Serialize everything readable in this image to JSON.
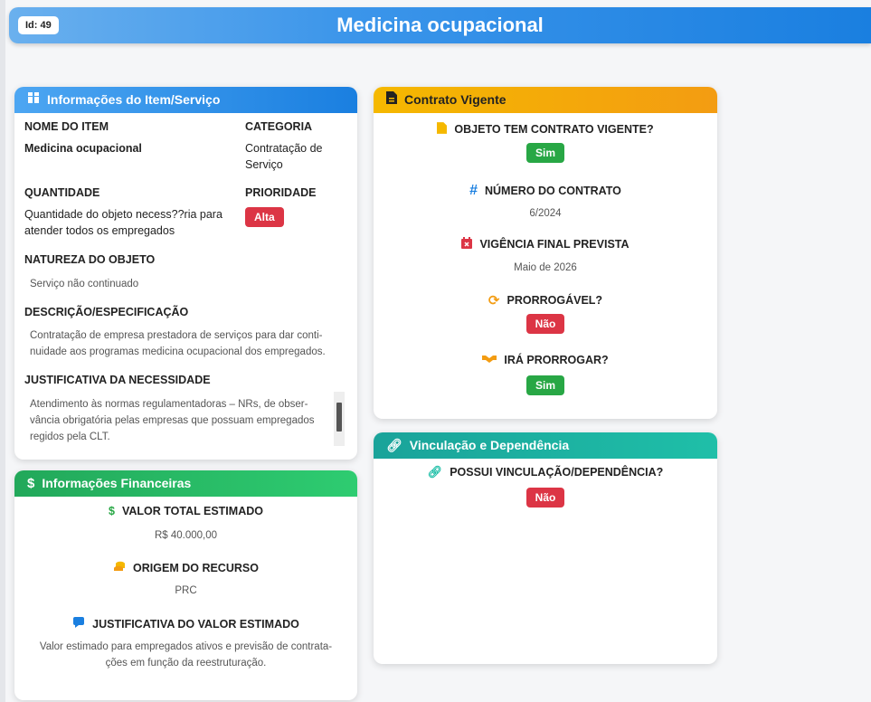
{
  "header": {
    "id_badge": "Id: 49",
    "title": "Medicina ocupacional"
  },
  "item_card": {
    "title": "Informações do Item/Serviço",
    "nome_label": "NOME DO ITEM",
    "nome_value": "Medicina ocupacional",
    "categoria_label": "CATEGORIA",
    "categoria_value": "Contratação de Serviço",
    "quantidade_label": "QUANTIDADE",
    "quantidade_value": "Quantidade do objeto necess??ria para atender todos os empregados",
    "prioridade_label": "PRIORIDADE",
    "prioridade_value": "Alta",
    "natureza_label": "NATUREZA DO OBJETO",
    "natureza_value": "Serviço não continuado",
    "descricao_label": "DESCRIÇÃO/ESPECIFICAÇÃO",
    "descricao_value": "Contratação de empresa prestadora de serviços para dar conti-nuidade aos programas medicina ocupacional dos empregados.",
    "justificativa_label": "JUSTIFICATIVA DA NECESSIDADE",
    "justificativa_value": "Atendimento às normas regulamentadoras – NRs, de obser-vância obrigatória pelas empresas que possuam empregados regidos pela CLT."
  },
  "finance_card": {
    "title": "Informações Financeiras",
    "valor_label": "VALOR TOTAL ESTIMADO",
    "valor_value": "R$ 40.000,00",
    "origem_label": "ORIGEM DO RECURSO",
    "origem_value": "PRC",
    "just_label": "JUSTIFICATIVA DO VALOR ESTIMADO",
    "just_value": "Valor estimado para empregados ativos e previsão de contrata-ções em função da reestruturação."
  },
  "contract_card": {
    "title": "Contrato Vigente",
    "objeto_label": "OBJETO TEM CONTRATO VIGENTE?",
    "objeto_value": "Sim",
    "numero_label": "NÚMERO DO CONTRATO",
    "numero_value": "6/2024",
    "vigencia_label": "VIGÊNCIA FINAL PREVISTA",
    "vigencia_value": "Maio de 2026",
    "prorrogavel_label": "PRORROGÁVEL?",
    "prorrogavel_value": "Não",
    "ira_label": "IRÁ PRORROGAR?",
    "ira_value": "Sim"
  },
  "link_card": {
    "title": "Vinculação e Dependência",
    "possui_label": "POSSUI VINCULAÇÃO/DEPENDÊNCIA?",
    "possui_value": "Não"
  },
  "colors": {
    "blue": "#1a7fe0",
    "green": "#28a745",
    "red": "#dc3545",
    "orange": "#f39c12",
    "teal": "#1fbfa8"
  },
  "icons": [
    "box-icon",
    "dollar-icon",
    "coins-icon",
    "comment-icon",
    "document-icon",
    "hash-icon",
    "calendar-icon",
    "refresh-icon",
    "handshake-icon",
    "link-icon"
  ]
}
